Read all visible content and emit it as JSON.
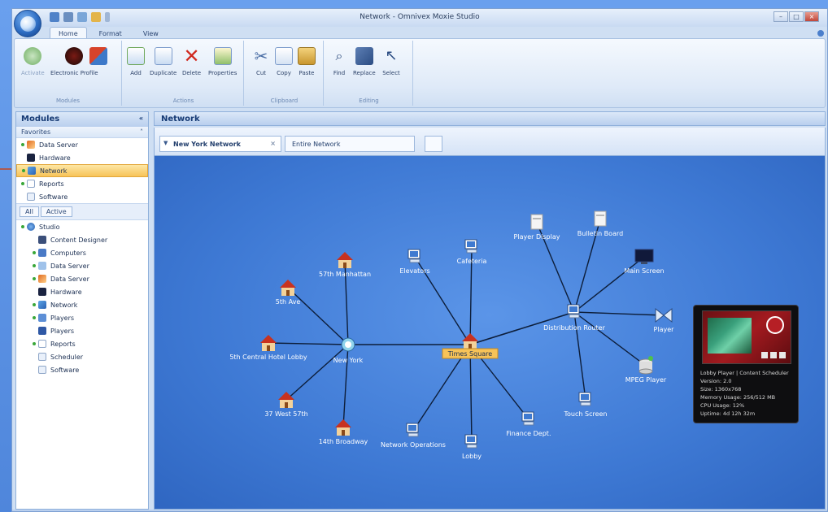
{
  "window": {
    "title": "Network - Omnivex Moxie Studio"
  },
  "ribbon": {
    "tabs": [
      "Home",
      "Format",
      "View"
    ],
    "groups": [
      {
        "label": "Modules",
        "buttons": [
          "Activate",
          "Electronic Profile"
        ]
      },
      {
        "label": "Actions",
        "buttons": [
          "Add",
          "Duplicate",
          "Delete",
          "Properties"
        ]
      },
      {
        "label": "Clipboard",
        "buttons": [
          "Cut",
          "Copy",
          "Paste"
        ]
      },
      {
        "label": "Editing",
        "buttons": [
          "Find",
          "Replace",
          "Select"
        ]
      }
    ]
  },
  "nav": {
    "header": "Modules",
    "favorites_label": "Favorites",
    "favorites": [
      {
        "label": "Data Server",
        "status": true
      },
      {
        "label": "Hardware",
        "status": false
      },
      {
        "label": "Network",
        "status": true,
        "selected": true
      },
      {
        "label": "Reports",
        "status": true
      },
      {
        "label": "Software",
        "status": false
      }
    ],
    "filter_tabs": [
      "All",
      "Active"
    ],
    "tree_root": "Studio",
    "tree": [
      {
        "label": "Content Designer",
        "status": false
      },
      {
        "label": "Computers",
        "status": true
      },
      {
        "label": "Data Server",
        "status": true
      },
      {
        "label": "Data Server",
        "status": true
      },
      {
        "label": "Hardware",
        "status": false
      },
      {
        "label": "Network",
        "status": true
      },
      {
        "label": "Players",
        "status": true
      },
      {
        "label": "Players",
        "status": false
      },
      {
        "label": "Reports",
        "status": true
      },
      {
        "label": "Scheduler",
        "status": false
      },
      {
        "label": "Software",
        "status": false
      }
    ]
  },
  "content": {
    "header": "Network",
    "tabs": [
      "New York Network",
      "Entire Network"
    ]
  },
  "network": {
    "hubs": [
      {
        "id": "newyork",
        "label": "New York"
      },
      {
        "id": "main",
        "label": "Times Square"
      },
      {
        "id": "dist",
        "label": "Distribution Router"
      }
    ],
    "nodes": [
      {
        "label": "57th Manhattan",
        "kind": "house"
      },
      {
        "label": "5th Ave",
        "kind": "house"
      },
      {
        "label": "5th Central Hotel Lobby",
        "kind": "house"
      },
      {
        "label": "37 West 57th",
        "kind": "house"
      },
      {
        "label": "14th Broadway",
        "kind": "house"
      },
      {
        "label": "Elevators",
        "kind": "pc"
      },
      {
        "label": "Cafeteria",
        "kind": "pc"
      },
      {
        "label": "Network Operations",
        "kind": "pc"
      },
      {
        "label": "Lobby",
        "kind": "pc"
      },
      {
        "label": "Finance Dept.",
        "kind": "pc"
      },
      {
        "label": "Player Display",
        "kind": "server"
      },
      {
        "label": "Bulletin Board",
        "kind": "server"
      },
      {
        "label": "Main Screen",
        "kind": "monitor"
      },
      {
        "label": "Player",
        "kind": "player"
      },
      {
        "label": "MPEG Player",
        "kind": "disk"
      },
      {
        "label": "Touch Screen",
        "kind": "pc"
      }
    ]
  },
  "preview": {
    "lines": [
      "Lobby Player | Content Scheduler",
      "Version: 2.0",
      "Size: 1360x768",
      "Memory Usage: 256/512 MB",
      "CPU Usage: 12%",
      "Uptime: 4d 12h 32m"
    ]
  },
  "colors": {
    "accent": "#3e79d4",
    "selection": "#f7c358",
    "callout_arrow": "#c8461e"
  }
}
